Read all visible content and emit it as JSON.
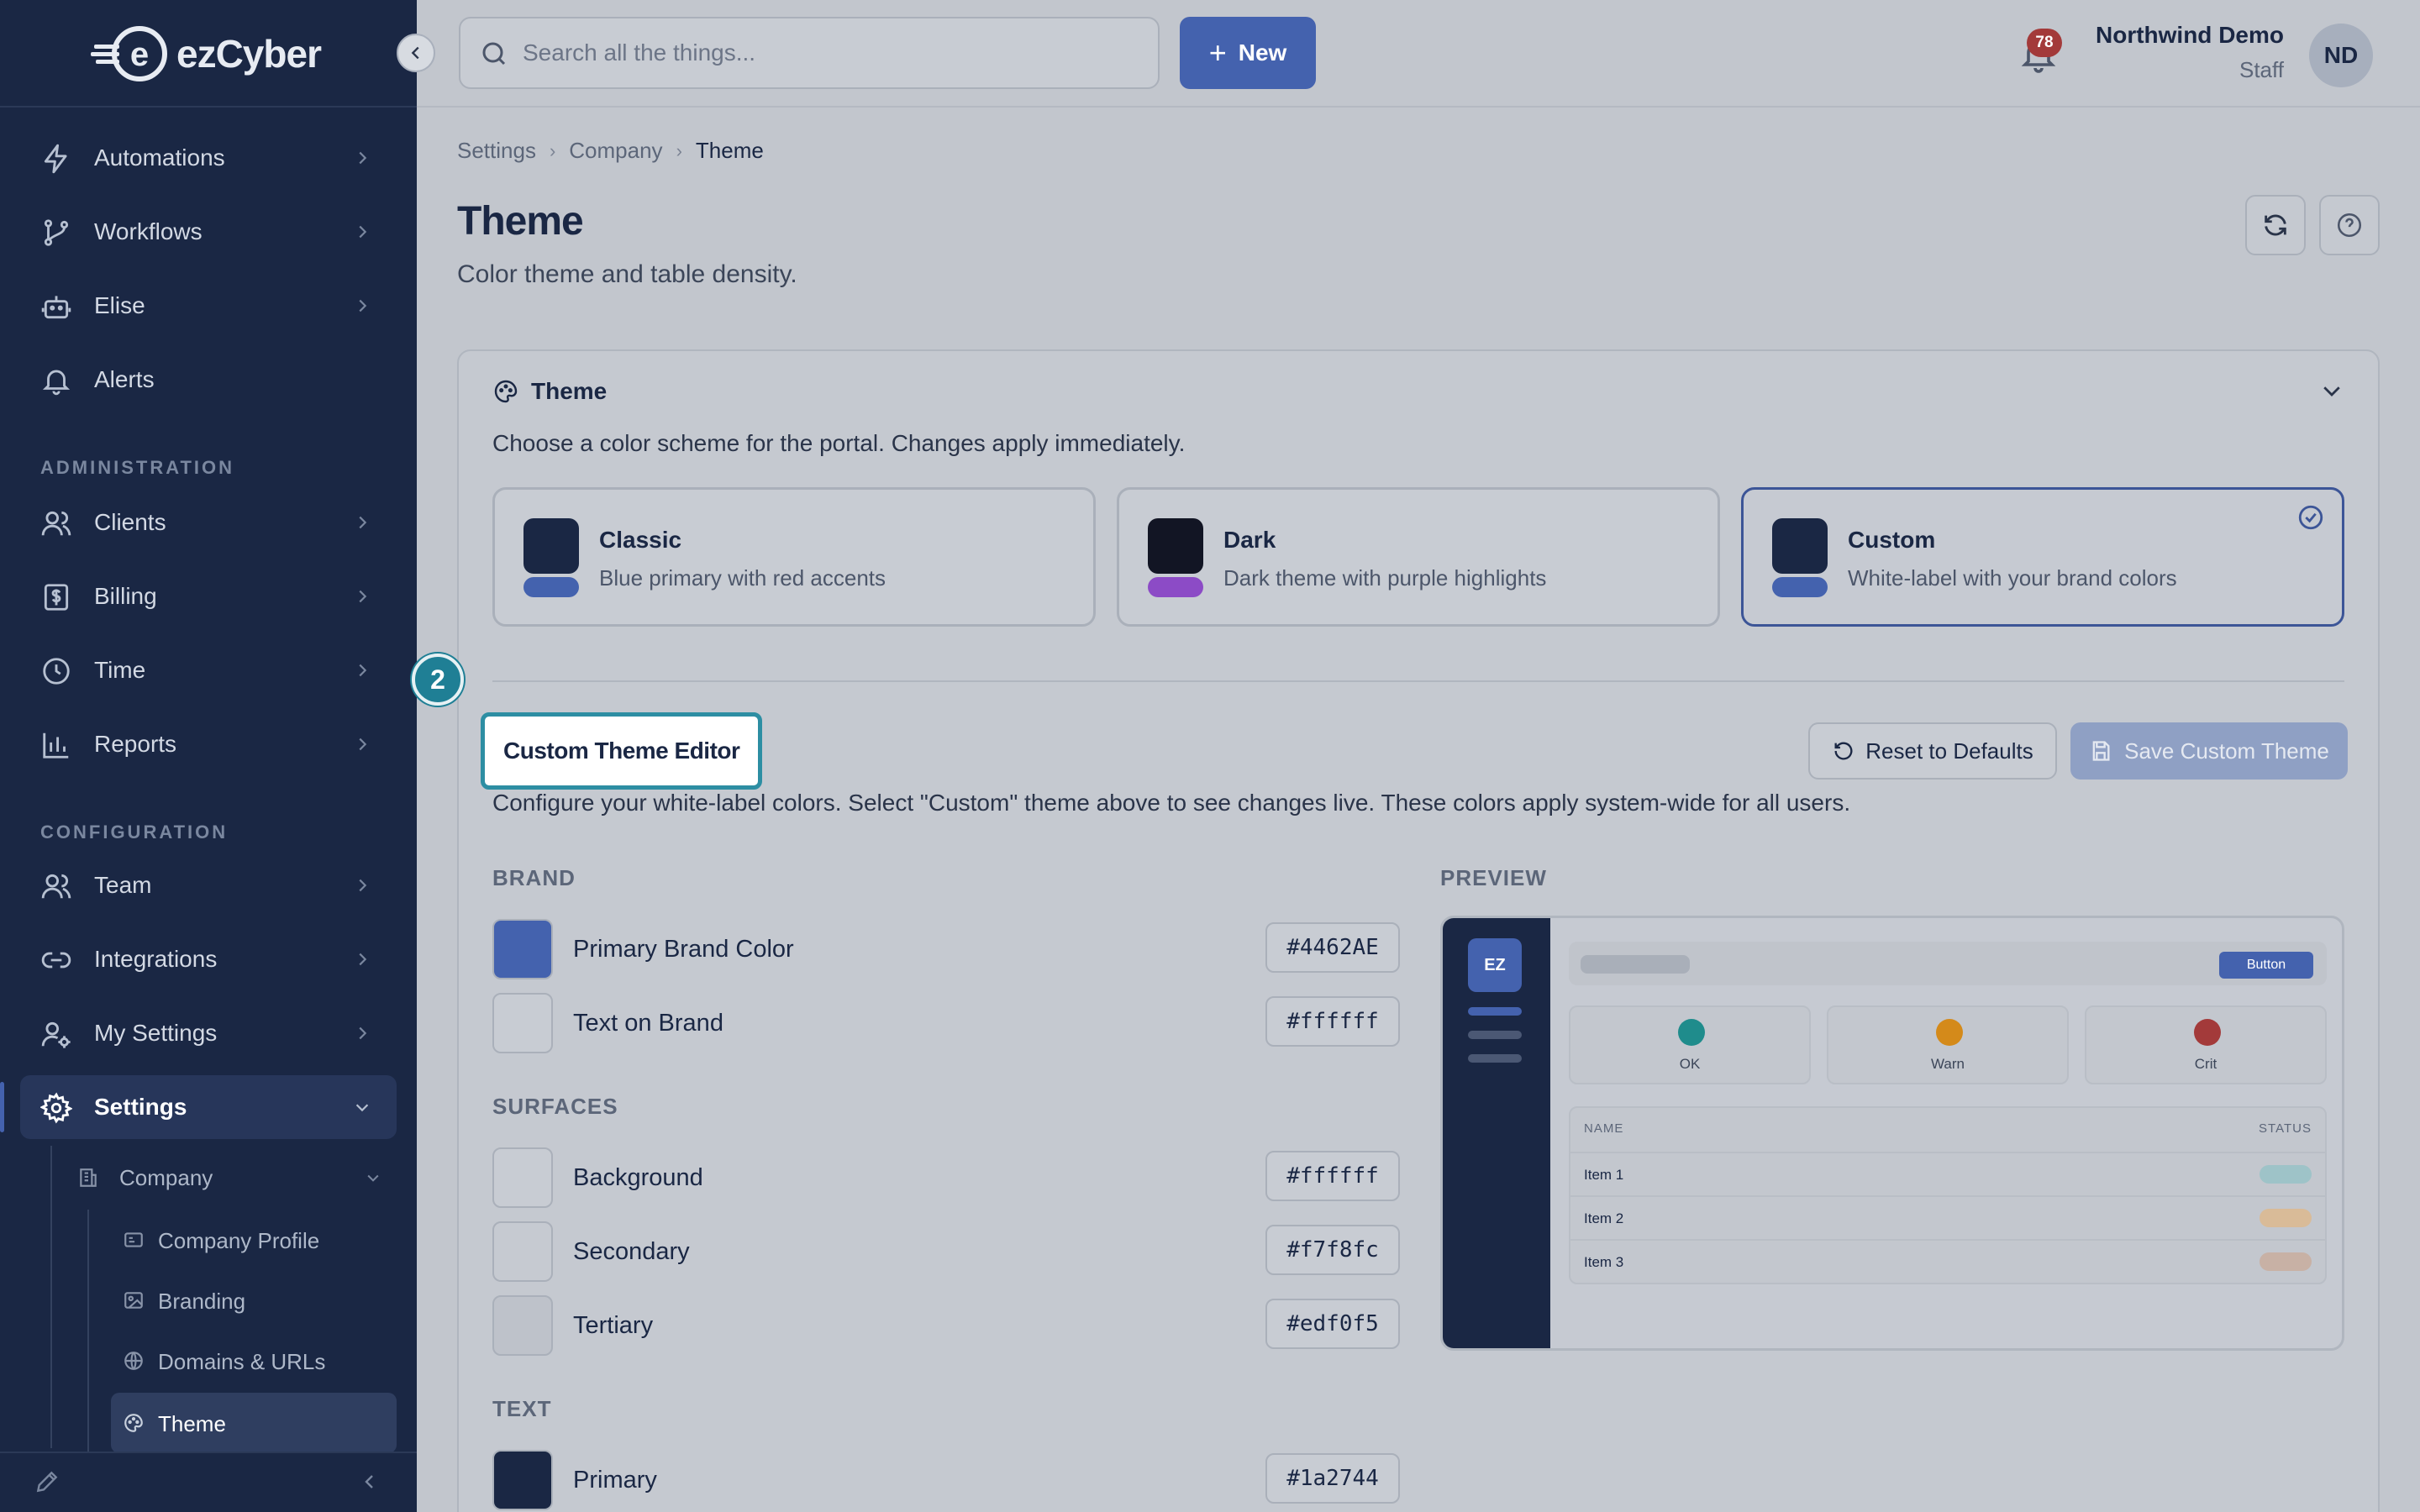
{
  "app": {
    "logo_e": "e",
    "logo_text": "ezCyber"
  },
  "sidebar": {
    "items_top": [
      {
        "label": "Automations",
        "icon": "lightning-icon"
      },
      {
        "label": "Workflows",
        "icon": "git-branch-icon"
      },
      {
        "label": "Elise",
        "icon": "robot-icon"
      },
      {
        "label": "Alerts",
        "icon": "bell-icon"
      }
    ],
    "section_admin": "ADMINISTRATION",
    "items_admin": [
      {
        "label": "Clients",
        "icon": "users-icon"
      },
      {
        "label": "Billing",
        "icon": "dollar-icon"
      },
      {
        "label": "Time",
        "icon": "clock-icon"
      },
      {
        "label": "Reports",
        "icon": "bar-chart-icon"
      }
    ],
    "section_config": "CONFIGURATION",
    "items_config": [
      {
        "label": "Team",
        "icon": "users-icon"
      },
      {
        "label": "Integrations",
        "icon": "link-icon"
      },
      {
        "label": "My Settings",
        "icon": "user-gear-icon"
      },
      {
        "label": "Settings",
        "icon": "gear-icon"
      }
    ],
    "sub_company": "Company",
    "sub_items": [
      "Company Profile",
      "Branding",
      "Domains & URLs",
      "Theme"
    ]
  },
  "topbar": {
    "search_placeholder": "Search all the things...",
    "new_label": "New",
    "notification_count": "78",
    "user_name": "Northwind Demo",
    "user_role": "Staff",
    "avatar_initials": "ND"
  },
  "breadcrumb": [
    "Settings",
    "Company",
    "Theme"
  ],
  "page": {
    "title": "Theme",
    "subtitle": "Color theme and table density."
  },
  "theme_card": {
    "title": "Theme",
    "description": "Choose a color scheme for the portal. Changes apply immediately.",
    "options": [
      {
        "name": "Classic",
        "desc": "Blue primary with red accents",
        "swatch_main": "#1a2744",
        "swatch_accent": "#4462ae",
        "selected": false
      },
      {
        "name": "Dark",
        "desc": "Dark theme with purple highlights",
        "swatch_main": "#121524",
        "swatch_accent": "#8c4bc6",
        "selected": false
      },
      {
        "name": "Custom",
        "desc": "White-label with your brand colors",
        "swatch_main": "#1a2744",
        "swatch_accent": "#4462ae",
        "selected": true
      }
    ]
  },
  "editor": {
    "step_number": "2",
    "title": "Custom Theme Editor",
    "reset_label": "Reset to Defaults",
    "save_label": "Save Custom Theme",
    "description": "Configure your white-label colors. Select \"Custom\" theme above to see changes live. These colors apply system-wide for all users.",
    "brand_label": "BRAND",
    "brand": [
      {
        "label": "Primary Brand Color",
        "hex": "#4462AE",
        "color": "#4462ae"
      },
      {
        "label": "Text on Brand",
        "hex": "#ffffff",
        "color": "#ffffff"
      }
    ],
    "surfaces_label": "SURFACES",
    "surfaces": [
      {
        "label": "Background",
        "hex": "#ffffff",
        "color": "#ffffff"
      },
      {
        "label": "Secondary",
        "hex": "#f7f8fc",
        "color": "#f7f8fc"
      },
      {
        "label": "Tertiary",
        "hex": "#edf0f5",
        "color": "#edf0f5"
      }
    ],
    "text_label": "TEXT",
    "text": [
      {
        "label": "Primary",
        "hex": "#1a2744",
        "color": "#1a2744"
      }
    ]
  },
  "preview": {
    "label": "PREVIEW",
    "logo": "EZ",
    "button": "Button",
    "stats": [
      {
        "label": "OK",
        "color": "#1f8c8c"
      },
      {
        "label": "Warn",
        "color": "#d48a1a"
      },
      {
        "label": "Crit",
        "color": "#a33a3a"
      }
    ],
    "table_headers": [
      "NAME",
      "STATUS"
    ],
    "rows": [
      {
        "name": "Item 1",
        "pill": "#9ec3c8"
      },
      {
        "name": "Item 2",
        "pill": "#d9bb98"
      },
      {
        "name": "Item 3",
        "pill": "#c8b1a5"
      }
    ]
  }
}
